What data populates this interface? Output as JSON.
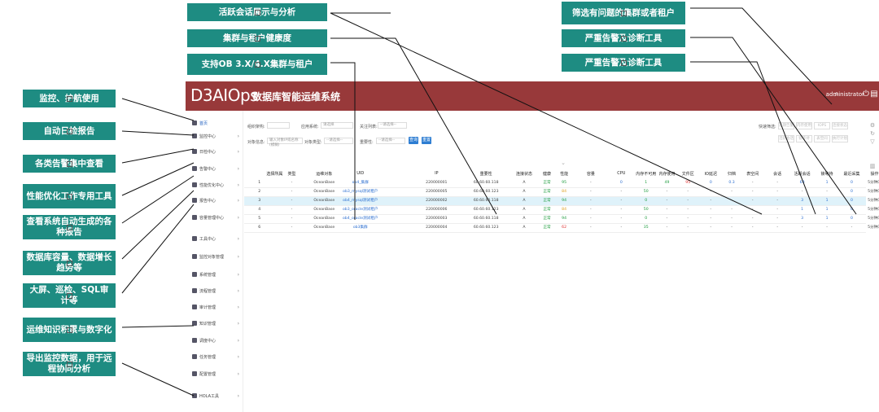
{
  "callouts_left": [
    "监控、护航使用",
    "自动日检报告",
    "各类告警集中查看",
    "性能优化工作专用工具",
    "查看系统自动生成的各种报告",
    "数据库容量、数据增长趋势等",
    "大屏、巡检、SQL审计等",
    "运维知识积累与数字化",
    "导出监控数据，用于远程协同分析"
  ],
  "callouts_top": [
    "活跃会话展示与分析",
    "集群与租户健康度",
    "支持OB 3.X/4.X集群与租户"
  ],
  "callouts_right": [
    "筛选有问题的集群或者租户",
    "严重告警及诊断工具",
    "严重告警及诊断工具"
  ],
  "app": {
    "logo": "D3AIOps",
    "title": "数据库智能运维系统",
    "user": "administrator",
    "brand_color": "#98393a"
  },
  "sidebar": [
    {
      "label": "首页"
    },
    {
      "label": "监控中心"
    },
    {
      "label": "日检中心"
    },
    {
      "label": "告警中心"
    },
    {
      "label": "性能优化中心"
    },
    {
      "label": "报告中心"
    },
    {
      "label": "容量管理中心"
    },
    {
      "label": "工具中心"
    },
    {
      "label": "监控对象管理"
    },
    {
      "label": "系统管理"
    },
    {
      "label": "流程管理"
    },
    {
      "label": "审计管理"
    },
    {
      "label": "知识管理"
    },
    {
      "label": "调度中心"
    },
    {
      "label": "任务管理"
    },
    {
      "label": "配置管理"
    },
    {
      "label": "HOLA工具"
    }
  ],
  "filters": {
    "org_label": "组织架构:",
    "app_label": "应用系统:",
    "app_placeholder": "请选择",
    "watch_label": "关注列表:",
    "watch_placeholder": "--请选择--",
    "obj_label": "对象信息:",
    "obj_placeholder": "输入对象IP或名称(模糊)",
    "type_label": "对象类型:",
    "type_placeholder": "--请选择--",
    "dep_label": "重要性:",
    "dep_placeholder": "--请选择--",
    "query_btn": "查询",
    "reset_btn": "重置",
    "quick_label": "快速筛选:",
    "quick_row1": [
      "近期告警",
      "内存使用",
      "IOPS",
      "连接状态"
    ],
    "quick_row2": [
      "活跃会话",
      "锁等待",
      "表空间",
      "执行计划"
    ]
  },
  "table": {
    "headers": [
      "选择所属",
      "类型",
      "运维对象",
      "UID",
      "IP",
      "重要性",
      "连接状态",
      "健康",
      "性能",
      "容量",
      "CPU",
      "内存不可用",
      "内存使用",
      "文件区",
      "IO延迟",
      "归档",
      "表空间",
      "会话",
      "活跃会话",
      "锁等待",
      "最近采集",
      "操作"
    ],
    "rows": [
      {
        "no": "1",
        "s": "-",
        "type": "OceanBase",
        "obj": "ob4_集群",
        "uid": "220000001",
        "ip": "60.60.60.118",
        "imp": "A",
        "conn": "正常",
        "health": "95",
        "perf": "-",
        "cap": "0",
        "cpu": "1",
        "mna": "49",
        "mem": "95",
        "file": "0",
        "io": "0.3",
        "arch": "-",
        "ts": "-",
        "sess": "69",
        "act": "1",
        "lock": "0",
        "last": "5分钟内"
      },
      {
        "no": "2",
        "s": "-",
        "type": "OceanBase",
        "obj": "ob3_mysql测试租户",
        "uid": "220000005",
        "ip": "60.60.60.123",
        "imp": "A",
        "conn": "正常",
        "health": "84",
        "perf": "-",
        "cap": "-",
        "cpu": "50",
        "mna": "-",
        "mem": "-",
        "file": "-",
        "io": "-",
        "arch": "-",
        "ts": "-",
        "sess": "-",
        "act": "-",
        "lock": "0",
        "last": "5分钟内"
      },
      {
        "no": "3",
        "s": "-",
        "type": "OceanBase",
        "obj": "ob4_mysql测试租户",
        "uid": "220000002",
        "ip": "60.60.60.118",
        "imp": "A",
        "conn": "正常",
        "health": "94",
        "perf": "-",
        "cap": "-",
        "cpu": "0",
        "mna": "-",
        "mem": "-",
        "file": "-",
        "io": "-",
        "arch": "-",
        "ts": "-",
        "sess": "3",
        "act": "1",
        "lock": "0",
        "last": "5分钟内"
      },
      {
        "no": "4",
        "s": "-",
        "type": "OceanBase",
        "obj": "ob3_oracle测试租户",
        "uid": "220000006",
        "ip": "60.60.60.123",
        "imp": "A",
        "conn": "正常",
        "health": "84",
        "perf": "-",
        "cap": "-",
        "cpu": "50",
        "mna": "-",
        "mem": "-",
        "file": "-",
        "io": "-",
        "arch": "-",
        "ts": "-",
        "sess": "1",
        "act": "1",
        "lock": "0",
        "last": "5分钟内"
      },
      {
        "no": "5",
        "s": "-",
        "type": "OceanBase",
        "obj": "ob4_oracle测试租户",
        "uid": "220000003",
        "ip": "60.60.60.118",
        "imp": "A",
        "conn": "正常",
        "health": "94",
        "perf": "-",
        "cap": "-",
        "cpu": "0",
        "mna": "-",
        "mem": "-",
        "file": "-",
        "io": "-",
        "arch": "-",
        "ts": "-",
        "sess": "3",
        "act": "1",
        "lock": "0",
        "last": "5分钟内"
      },
      {
        "no": "6",
        "s": "-",
        "type": "OceanBase",
        "obj": "ob3集群",
        "uid": "220000004",
        "ip": "60.60.60.123",
        "imp": "A",
        "conn": "正常",
        "health": "62",
        "perf": "-",
        "cap": "-",
        "cpu": "35",
        "mna": "-",
        "mem": "-",
        "file": "-",
        "io": "-",
        "arch": "-",
        "ts": "-",
        "sess": "-",
        "act": "-",
        "lock": "-",
        "last": "5分钟内"
      }
    ]
  },
  "colors": {
    "callout": "#1e8c82",
    "link": "#2d6fd0",
    "ok": "#1a9a3a",
    "warn": "#e0a020",
    "bad": "#e03030"
  }
}
